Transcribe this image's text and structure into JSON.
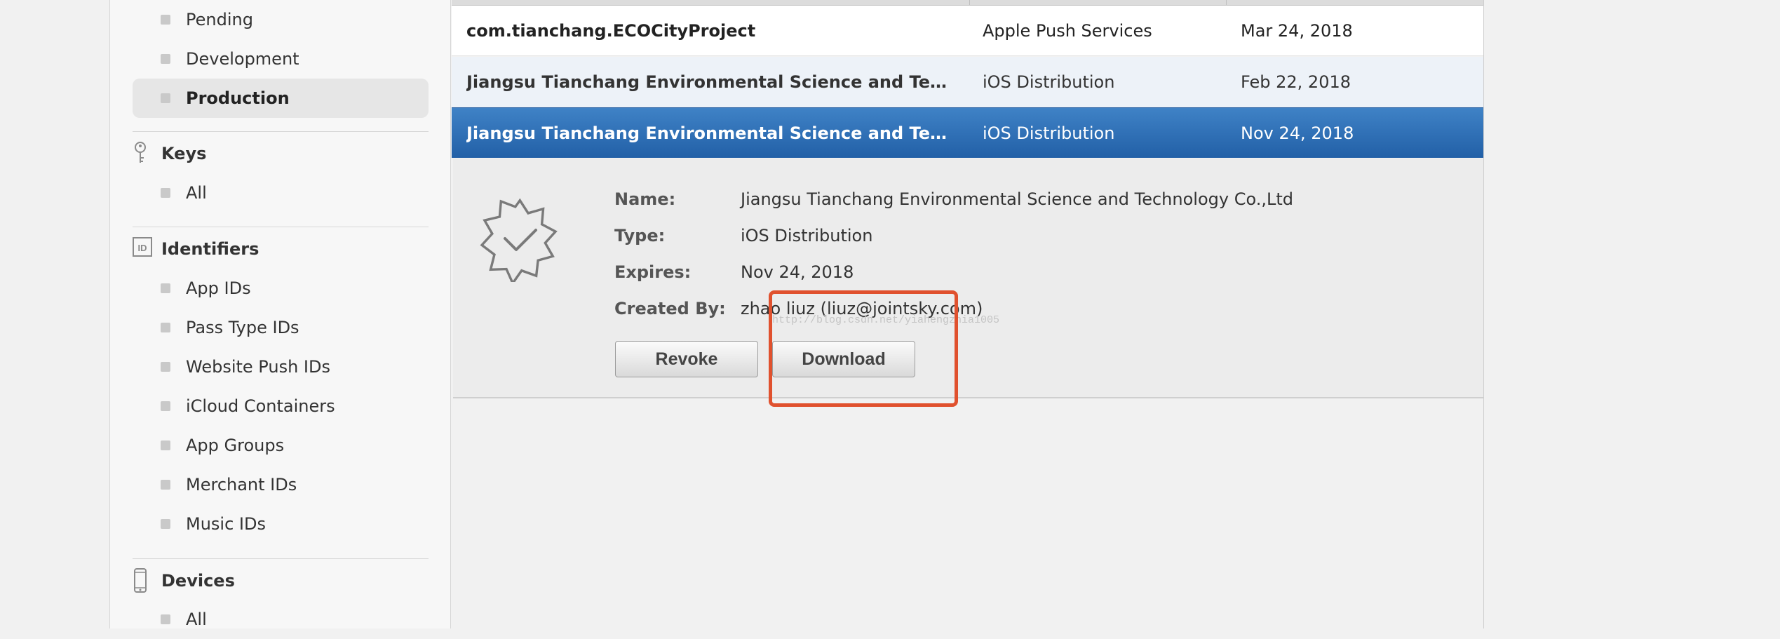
{
  "sidebar": {
    "certificates_items": [
      {
        "label": "Pending"
      },
      {
        "label": "Development"
      },
      {
        "label": "Production",
        "active": true
      }
    ],
    "keys": {
      "title": "Keys",
      "items": [
        {
          "label": "All"
        }
      ]
    },
    "identifiers": {
      "title": "Identifiers",
      "icon_text": "ID",
      "items": [
        {
          "label": "App IDs"
        },
        {
          "label": "Pass Type IDs"
        },
        {
          "label": "Website Push IDs"
        },
        {
          "label": "iCloud Containers"
        },
        {
          "label": "App Groups"
        },
        {
          "label": "Merchant IDs"
        },
        {
          "label": "Music IDs"
        }
      ]
    },
    "devices": {
      "title": "Devices",
      "items": [
        {
          "label": "All"
        }
      ]
    }
  },
  "table": {
    "rows": [
      {
        "name": "com.tianchang.ECOCityProject",
        "type": "Apple Push Services",
        "expires": "Mar 24, 2018"
      },
      {
        "name": "Jiangsu Tianchang Environmental Science and Technology Co.,Ltd",
        "type": "iOS Distribution",
        "expires": "Feb 22, 2018"
      },
      {
        "name": "Jiangsu Tianchang Environmental Science and Technology Co.,Ltd",
        "type": "iOS Distribution",
        "expires": "Nov 24, 2018",
        "selected": true
      }
    ]
  },
  "detail": {
    "labels": {
      "name": "Name:",
      "type": "Type:",
      "expires": "Expires:",
      "created_by": "Created By:"
    },
    "name": "Jiangsu Tianchang Environmental Science and Technology Co.,Ltd",
    "type": "iOS Distribution",
    "expires": "Nov 24, 2018",
    "created_by": "zhao liuz (liuz@jointsky.com)",
    "revoke_label": "Revoke",
    "download_label": "Download",
    "watermark": "http://blog.csdn.net/yiahengzhia1005"
  },
  "colors": {
    "selected_row": "#2c6db3",
    "highlight_box": "#e0512e",
    "alt_row": "#edf2f8"
  },
  "icons": {
    "keys": "key-icon",
    "identifiers": "id-icon",
    "devices": "iphone-icon",
    "certificate": "certificate-seal-icon"
  }
}
